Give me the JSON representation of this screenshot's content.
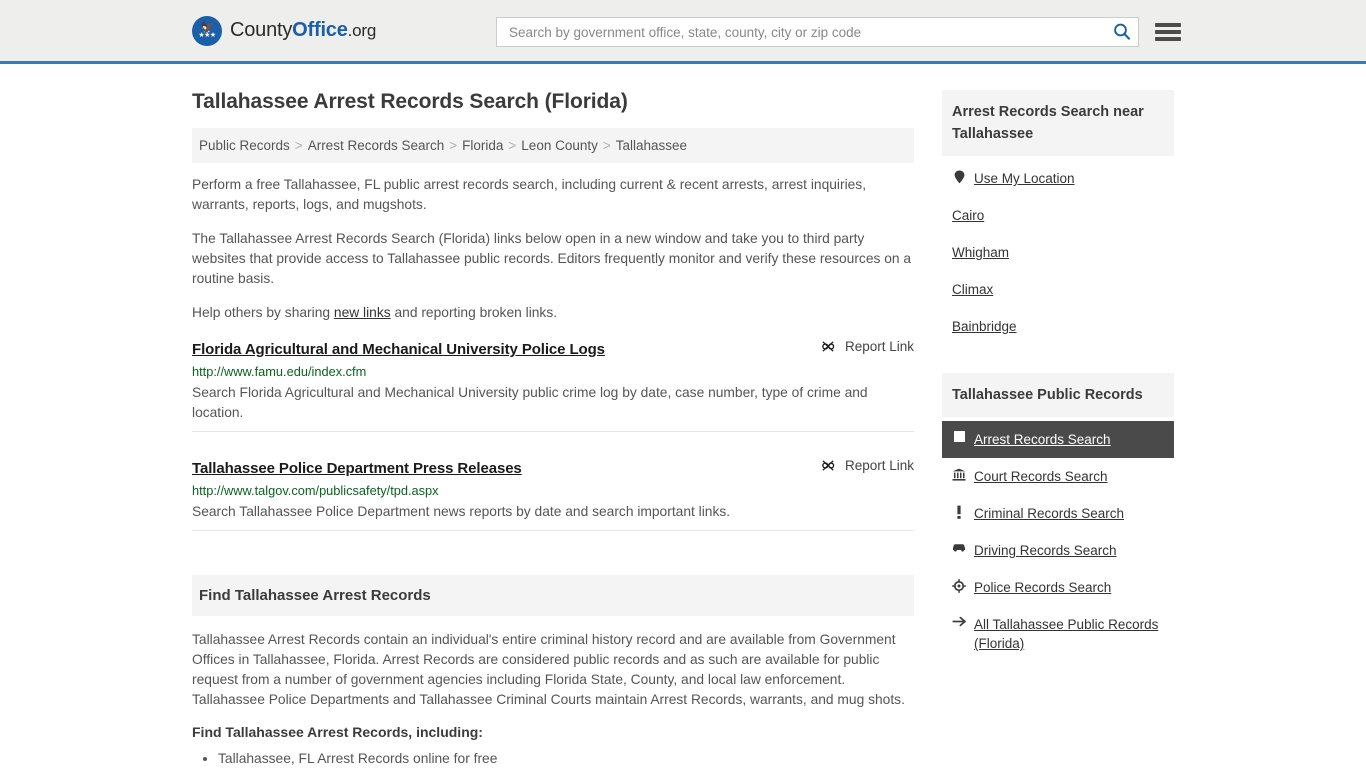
{
  "header": {
    "logo": {
      "part1": "County",
      "part2": "Office",
      "part3": ".org",
      "icon": "eagle-shield-icon"
    },
    "search": {
      "placeholder": "Search by government office, state, county, city or zip code",
      "value": "",
      "icon": "search-icon"
    },
    "menu_icon": "hamburger-menu-icon",
    "accent_color": "#3b7aad",
    "background_color": "#eeeeec"
  },
  "page_title": "Tallahassee Arrest Records Search (Florida)",
  "breadcrumb": {
    "separator": ">",
    "items": [
      {
        "label": "Public Records"
      },
      {
        "label": "Arrest Records Search"
      },
      {
        "label": "Florida"
      },
      {
        "label": "Leon County"
      },
      {
        "label": "Tallahassee"
      }
    ]
  },
  "intro": {
    "p1": "Perform a free Tallahassee, FL public arrest records search, including current & recent arrests, arrest inquiries, warrants, reports, logs, and mugshots.",
    "p2": "The Tallahassee Arrest Records Search (Florida) links below open in a new window and take you to third party websites that provide access to Tallahassee public records. Editors frequently monitor and verify these resources on a routine basis.",
    "p3_before": "Help others by sharing ",
    "p3_link": "new links",
    "p3_after": " and reporting broken links."
  },
  "results": {
    "report_link_label": "Report Link",
    "report_link_icon": "broken-link-icon",
    "items": [
      {
        "title": "Florida Agricultural and Mechanical University Police Logs",
        "url": "http://www.famu.edu/index.cfm",
        "description": "Search Florida Agricultural and Mechanical University public crime log by date, case number, type of crime and location."
      },
      {
        "title": " Tallahassee Police Department Press Releases",
        "url": "http://www.talgov.com/publicsafety/tpd.aspx",
        "description": "Search Tallahassee Police Department news reports by date and search important links."
      }
    ]
  },
  "find_section": {
    "heading": "Find Tallahassee Arrest Records",
    "paragraph": "Tallahassee Arrest Records contain an individual's entire criminal history record and are available from Government Offices in Tallahassee, Florida. Arrest Records are considered public records and as such are available for public request from a number of government agencies including Florida State, County, and local law enforcement. Tallahassee Police Departments and Tallahassee Criminal Courts maintain Arrest Records, warrants, and mug shots.",
    "sub_heading": "Find Tallahassee Arrest Records, including:",
    "bullets": [
      "Tallahassee, FL Arrest Records online for free"
    ]
  },
  "sidebar": {
    "near": {
      "heading": "Arrest Records Search near Tallahassee",
      "items": [
        {
          "label": "Use My Location",
          "icon": "map-pin-icon"
        },
        {
          "label": "Cairo",
          "icon": "none"
        },
        {
          "label": "Whigham",
          "icon": "none"
        },
        {
          "label": "Climax",
          "icon": "none"
        },
        {
          "label": "Bainbridge",
          "icon": "none"
        }
      ]
    },
    "records": {
      "heading": "Tallahassee Public Records",
      "active_color": "#4a4a4a",
      "items": [
        {
          "label": "Arrest Records Search",
          "icon": "white-square-icon",
          "active": true
        },
        {
          "label": "Court Records Search",
          "icon": "courthouse-icon",
          "active": false
        },
        {
          "label": "Criminal Records Search",
          "icon": "exclamation-icon",
          "active": false
        },
        {
          "label": "Driving Records Search",
          "icon": "car-icon",
          "active": false
        },
        {
          "label": "Police Records Search",
          "icon": "target-badge-icon",
          "active": false
        },
        {
          "label": "All Tallahassee Public Records (Florida)",
          "icon": "arrow-right-icon",
          "active": false
        }
      ]
    }
  }
}
